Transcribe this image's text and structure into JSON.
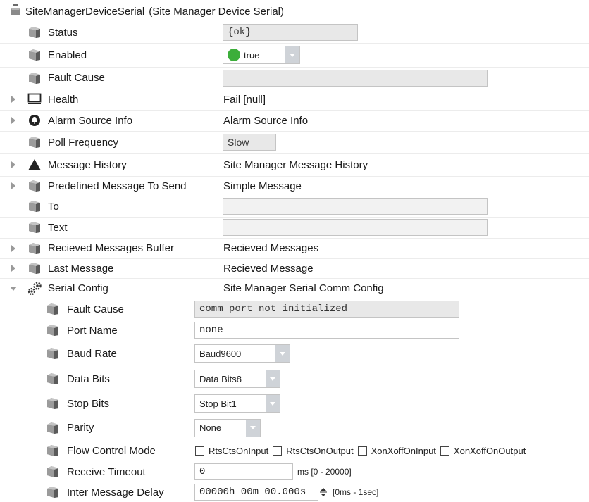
{
  "header": {
    "name": "SiteManagerDeviceSerial",
    "display": "(Site Manager Device Serial)"
  },
  "rows": {
    "status": {
      "label": "Status",
      "value": "{ok}"
    },
    "enabled": {
      "label": "Enabled",
      "value": "true"
    },
    "fault_cause": {
      "label": "Fault Cause",
      "value": ""
    },
    "health": {
      "label": "Health",
      "value": "Fail [null]"
    },
    "alarm_source_info": {
      "label": "Alarm Source Info",
      "value": "Alarm Source Info"
    },
    "poll_frequency": {
      "label": "Poll Frequency",
      "value": "Slow"
    },
    "message_history": {
      "label": "Message History",
      "value": "Site Manager Message History"
    },
    "predefined_message": {
      "label": "Predefined Message To Send",
      "value": "Simple Message"
    },
    "to": {
      "label": "To",
      "value": ""
    },
    "text": {
      "label": "Text",
      "value": ""
    },
    "received_buffer": {
      "label": "Recieved Messages Buffer",
      "value": "Recieved Messages"
    },
    "last_message": {
      "label": "Last Message",
      "value": "Recieved Message"
    },
    "serial_config": {
      "label": "Serial Config",
      "value": "Site Manager Serial Comm Config"
    }
  },
  "serial": {
    "fault_cause": {
      "label": "Fault Cause",
      "value": "comm port not initialized"
    },
    "port_name": {
      "label": "Port Name",
      "value": "none"
    },
    "baud_rate": {
      "label": "Baud Rate",
      "value": "Baud9600"
    },
    "data_bits": {
      "label": "Data Bits",
      "value": "Data Bits8"
    },
    "stop_bits": {
      "label": "Stop Bits",
      "value": "Stop Bit1"
    },
    "parity": {
      "label": "Parity",
      "value": "None"
    },
    "flow_control": {
      "label": "Flow Control Mode",
      "options": [
        "RtsCtsOnInput",
        "RtsCtsOnOutput",
        "XonXoffOnInput",
        "XonXoffOnOutput"
      ]
    },
    "receive_timeout": {
      "label": "Receive Timeout",
      "value": "0",
      "range": "ms [0 - 20000]"
    },
    "inter_message_delay": {
      "label": "Inter Message Delay",
      "value": "00000h 00m 00.000s",
      "range": "[0ms - 1sec]"
    }
  },
  "colors": {
    "enabled_dot": "#3cae3a",
    "dropdown_arrow_bg": "#cfd3d8"
  }
}
